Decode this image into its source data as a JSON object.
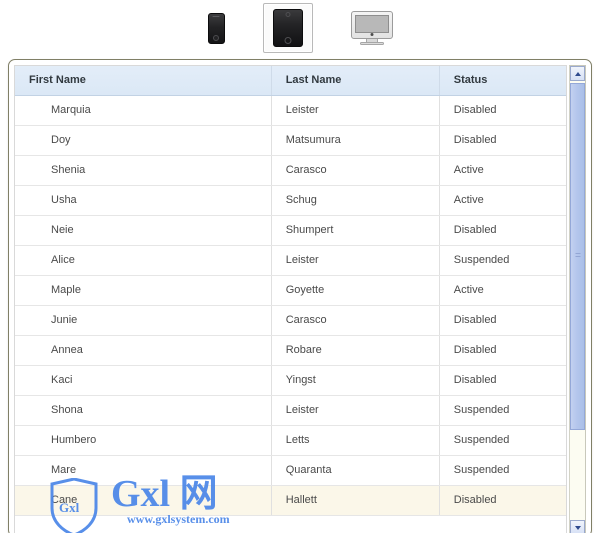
{
  "device_bar": {
    "devices": [
      {
        "id": "phone",
        "label": "Phone",
        "icon": "phone-icon",
        "selected": false
      },
      {
        "id": "tablet",
        "label": "Tablet",
        "icon": "tablet-icon",
        "selected": true
      },
      {
        "id": "desktop",
        "label": "Desktop",
        "icon": "desktop-icon",
        "selected": false
      }
    ]
  },
  "table": {
    "columns": [
      "First Name",
      "Last Name",
      "Status"
    ],
    "rows": [
      {
        "first": "Marquia",
        "last": "Leister",
        "status": "Disabled",
        "highlight": false
      },
      {
        "first": "Doy",
        "last": "Matsumura",
        "status": "Disabled",
        "highlight": false
      },
      {
        "first": "Shenia",
        "last": "Carasco",
        "status": "Active",
        "highlight": false
      },
      {
        "first": "Usha",
        "last": "Schug",
        "status": "Active",
        "highlight": false
      },
      {
        "first": "Neie",
        "last": "Shumpert",
        "status": "Disabled",
        "highlight": false
      },
      {
        "first": "Alice",
        "last": "Leister",
        "status": "Suspended",
        "highlight": false
      },
      {
        "first": "Maple",
        "last": "Goyette",
        "status": "Active",
        "highlight": false
      },
      {
        "first": "Junie",
        "last": "Carasco",
        "status": "Disabled",
        "highlight": false
      },
      {
        "first": "Annea",
        "last": "Robare",
        "status": "Disabled",
        "highlight": false
      },
      {
        "first": "Kaci",
        "last": "Yingst",
        "status": "Disabled",
        "highlight": false
      },
      {
        "first": "Shona",
        "last": "Leister",
        "status": "Suspended",
        "highlight": false
      },
      {
        "first": "Humbero",
        "last": "Letts",
        "status": "Suspended",
        "highlight": false
      },
      {
        "first": "Mare",
        "last": "Quaranta",
        "status": "Suspended",
        "highlight": false
      },
      {
        "first": "Cane",
        "last": "Hallett",
        "status": "Disabled",
        "highlight": true
      }
    ]
  },
  "scrollbar": {
    "up_icon": "chevron-up-icon",
    "down_icon": "chevron-down-icon",
    "thumb_fraction": "79%"
  },
  "watermark": {
    "brand": "Gxl 网",
    "url": "www.gxlsystem.com",
    "shield_label": "Gxl",
    "color": "#4a86e8"
  },
  "colors": {
    "header_bg": "#dbe8f6",
    "header_text": "#31393f",
    "row_text": "#4a4a4a",
    "row_highlight_bg": "#fbf7e9",
    "panel_border": "#807f66",
    "scrollbar_thumb": "#b4c6ec"
  }
}
